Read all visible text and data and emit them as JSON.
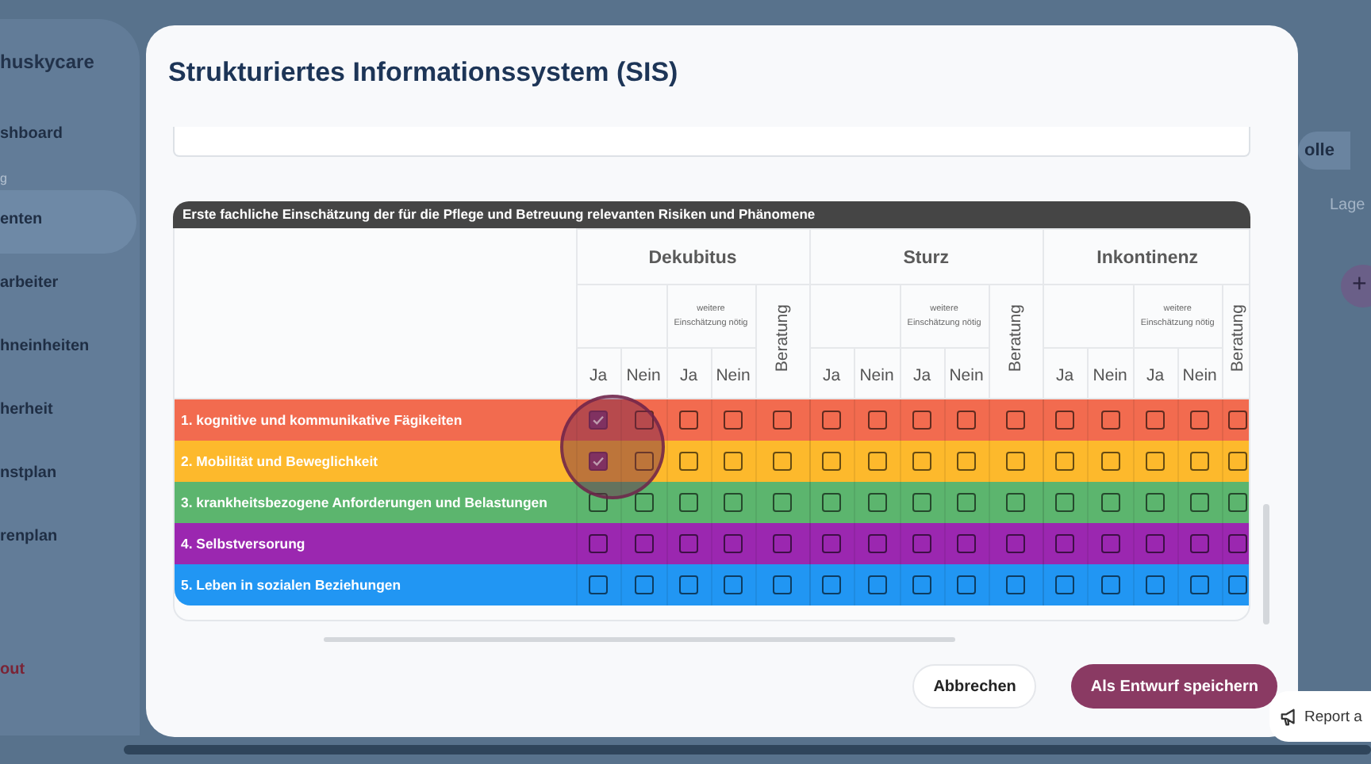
{
  "app": {
    "logo": "huskycare",
    "sidebar": {
      "items": [
        {
          "label": "shboard",
          "kind": "item",
          "selected": false
        },
        {
          "label": "g",
          "kind": "section"
        },
        {
          "label": "enten",
          "kind": "item",
          "selected": true
        },
        {
          "label": "arbeiter",
          "kind": "item",
          "selected": false
        },
        {
          "label": "hneinheiten",
          "kind": "item",
          "selected": false
        },
        {
          "label": "herheit",
          "kind": "item",
          "selected": false
        },
        {
          "label": "nstplan",
          "kind": "item",
          "selected": false
        },
        {
          "label": "renplan",
          "kind": "item",
          "selected": false
        },
        {
          "label": "out",
          "kind": "logout"
        }
      ]
    },
    "page": {
      "role_button": "olle",
      "field_label": "Lage",
      "add_button": "+"
    },
    "report_button": "Report a"
  },
  "modal": {
    "title": "Strukturiertes Informationssystem (SIS)",
    "table_title": "Erste fachliche Einschätzung der für die Pflege und Betreuung relevanten Risiken und Phänomene",
    "groups": [
      {
        "name": "Dekubitus",
        "sub_label": "weitere Einschätzung nötig",
        "columns": [
          "Ja",
          "Nein",
          "Ja",
          "Nein",
          "Beratung"
        ]
      },
      {
        "name": "Sturz",
        "sub_label": "weitere Einschätzung nötig",
        "columns": [
          "Ja",
          "Nein",
          "Ja",
          "Nein",
          "Beratung"
        ]
      },
      {
        "name": "Inkontinenz",
        "sub_label": "weitere Einschätzung nötig",
        "columns": [
          "Ja",
          "Nein",
          "Ja",
          "Nein",
          "Beratung"
        ]
      }
    ],
    "rows": [
      {
        "label": "1. kognitive und kommunikative Fägikeiten",
        "color": "#f26b4f",
        "checks": [
          {
            "checked": true
          },
          {
            "checked": false
          },
          {
            "checked": false
          },
          {
            "checked": false
          },
          {
            "checked": false
          },
          {
            "checked": false
          },
          {
            "checked": false
          },
          {
            "checked": false
          },
          {
            "checked": false
          },
          {
            "checked": false
          },
          {
            "checked": false
          },
          {
            "checked": false
          },
          {
            "checked": false
          },
          {
            "checked": false
          },
          {
            "checked": false
          }
        ]
      },
      {
        "label": "2. Mobilität und Beweglichkeit",
        "color": "#fdb92c",
        "checks": [
          {
            "checked": true
          },
          {
            "checked": false
          },
          {
            "checked": false
          },
          {
            "checked": false
          },
          {
            "checked": false
          },
          {
            "checked": false
          },
          {
            "checked": false
          },
          {
            "checked": false
          },
          {
            "checked": false
          },
          {
            "checked": false
          },
          {
            "checked": false
          },
          {
            "checked": false
          },
          {
            "checked": false
          },
          {
            "checked": false
          },
          {
            "checked": false
          }
        ]
      },
      {
        "label": "3. krankheitsbezogene Anforderungen und Belastungen",
        "color": "#5cb56e",
        "checks": [
          {
            "checked": false
          },
          {
            "checked": false
          },
          {
            "checked": false
          },
          {
            "checked": false
          },
          {
            "checked": false
          },
          {
            "checked": false
          },
          {
            "checked": false
          },
          {
            "checked": false
          },
          {
            "checked": false
          },
          {
            "checked": false
          },
          {
            "checked": false
          },
          {
            "checked": false
          },
          {
            "checked": false
          },
          {
            "checked": false
          },
          {
            "checked": false
          }
        ]
      },
      {
        "label": "4. Selbstversorung",
        "color": "#9b27b0",
        "checks": [
          {
            "checked": false
          },
          {
            "checked": false
          },
          {
            "checked": false
          },
          {
            "checked": false
          },
          {
            "checked": false
          },
          {
            "checked": false
          },
          {
            "checked": false
          },
          {
            "checked": false
          },
          {
            "checked": false
          },
          {
            "checked": false
          },
          {
            "checked": false
          },
          {
            "checked": false
          },
          {
            "checked": false
          },
          {
            "checked": false
          },
          {
            "checked": false
          }
        ]
      },
      {
        "label": "5. Leben in sozialen Beziehungen",
        "color": "#2196f3",
        "checks": [
          {
            "checked": false
          },
          {
            "checked": false
          },
          {
            "checked": false
          },
          {
            "checked": false
          },
          {
            "checked": false
          },
          {
            "checked": false
          },
          {
            "checked": false
          },
          {
            "checked": false
          },
          {
            "checked": false
          },
          {
            "checked": false
          },
          {
            "checked": false
          },
          {
            "checked": false
          },
          {
            "checked": false
          },
          {
            "checked": false
          },
          {
            "checked": false
          }
        ]
      }
    ],
    "buttons": [
      {
        "label": "Abbrechen",
        "kind": "secondary"
      },
      {
        "label": "Als Entwurf speichern",
        "kind": "primary"
      }
    ]
  }
}
